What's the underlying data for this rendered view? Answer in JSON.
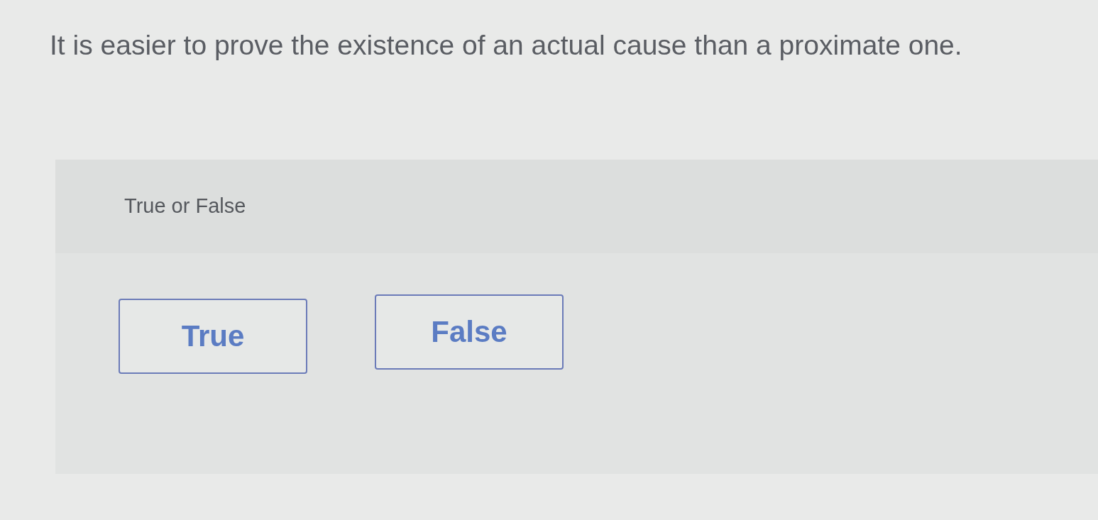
{
  "question": {
    "text": "It is easier to prove the existence of an actual cause than a proximate one."
  },
  "answer_panel": {
    "instruction": "True or False",
    "options": [
      {
        "label": "True",
        "selected": false
      },
      {
        "label": "False",
        "selected": false
      }
    ]
  }
}
